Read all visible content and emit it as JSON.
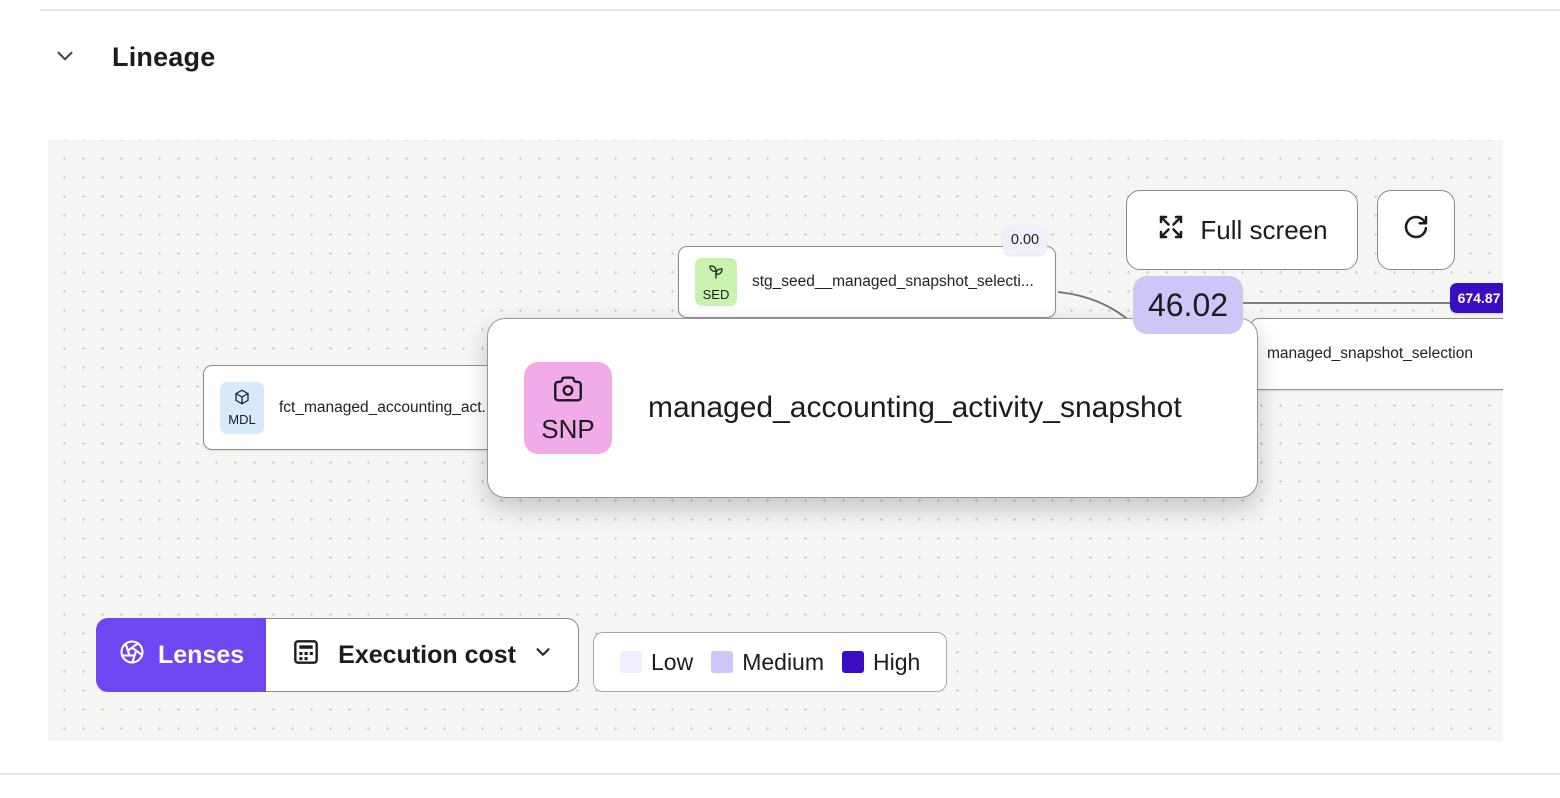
{
  "header": {
    "title": "Lineage"
  },
  "toolbar": {
    "full_screen_label": "Full screen"
  },
  "nodes": {
    "fct": {
      "type": "MDL",
      "icon": "cube-icon",
      "label": "fct_managed_accounting_act...",
      "badge_color": "#d8e9fc"
    },
    "seed": {
      "type": "SED",
      "icon": "seedling-icon",
      "label": "stg_seed__managed_snapshot_selecti...",
      "badge_color": "#c9f2ae",
      "cost": "0.00"
    },
    "selection": {
      "label": "managed_snapshot_selection",
      "cost": "674.87"
    },
    "hovered": {
      "type": "SNP",
      "icon": "camera-icon",
      "label": "managed_accounting_activity_snapshot",
      "badge_color": "#f2abe9",
      "cost": "46.02"
    }
  },
  "lenses": {
    "button_label": "Lenses",
    "button_color": "#6c47f2",
    "selected_lens": "Execution cost"
  },
  "legend": {
    "items": [
      {
        "label": "Low",
        "color": "#f1effc"
      },
      {
        "label": "Medium",
        "color": "#cdc6f6"
      },
      {
        "label": "High",
        "color": "#3a0dc2"
      }
    ]
  }
}
